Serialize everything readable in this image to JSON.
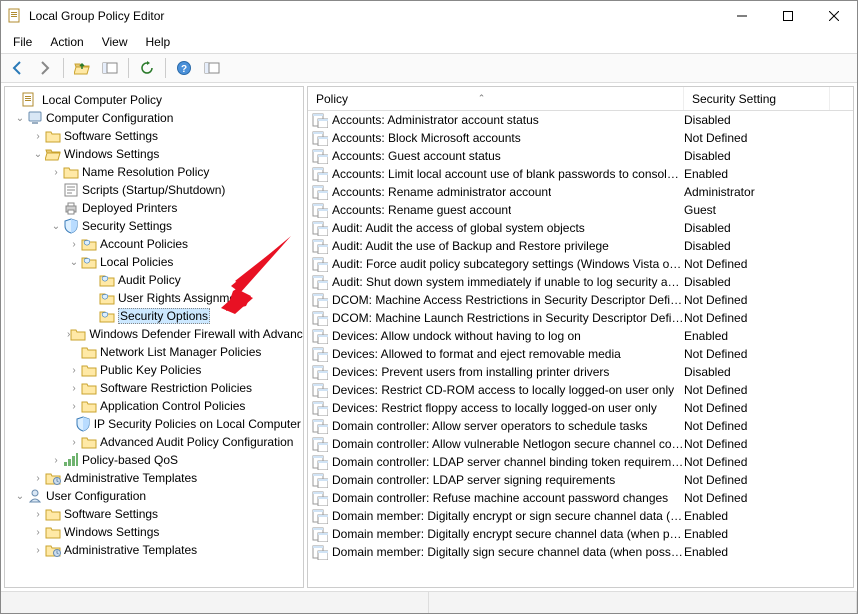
{
  "window": {
    "title": "Local Group Policy Editor"
  },
  "menu": {
    "file": "File",
    "action": "Action",
    "view": "View",
    "help": "Help"
  },
  "columns": {
    "policy": "Policy",
    "setting": "Security Setting"
  },
  "tree": {
    "root": "Local Computer Policy",
    "computer_config": "Computer Configuration",
    "software_settings_c": "Software Settings",
    "windows_settings_c": "Windows Settings",
    "name_res": "Name Resolution Policy",
    "scripts": "Scripts (Startup/Shutdown)",
    "deployed_printers": "Deployed Printers",
    "security_settings": "Security Settings",
    "account_policies": "Account Policies",
    "local_policies": "Local Policies",
    "audit_policy": "Audit Policy",
    "user_rights": "User Rights Assignment",
    "security_options": "Security Options",
    "wdf": "Windows Defender Firewall with Advanced Security",
    "nlmp": "Network List Manager Policies",
    "pkp": "Public Key Policies",
    "srp": "Software Restriction Policies",
    "acp": "Application Control Policies",
    "ipsec": "IP Security Policies on Local Computer",
    "aapc": "Advanced Audit Policy Configuration",
    "qos": "Policy-based QoS",
    "admin_tmpl_c": "Administrative Templates",
    "user_config": "User Configuration",
    "software_settings_u": "Software Settings",
    "windows_settings_u": "Windows Settings",
    "admin_tmpl_u": "Administrative Templates"
  },
  "policies": [
    {
      "name": "Accounts: Administrator account status",
      "setting": "Disabled"
    },
    {
      "name": "Accounts: Block Microsoft accounts",
      "setting": "Not Defined"
    },
    {
      "name": "Accounts: Guest account status",
      "setting": "Disabled"
    },
    {
      "name": "Accounts: Limit local account use of blank passwords to console logon only",
      "setting": "Enabled"
    },
    {
      "name": "Accounts: Rename administrator account",
      "setting": "Administrator"
    },
    {
      "name": "Accounts: Rename guest account",
      "setting": "Guest"
    },
    {
      "name": "Audit: Audit the access of global system objects",
      "setting": "Disabled"
    },
    {
      "name": "Audit: Audit the use of Backup and Restore privilege",
      "setting": "Disabled"
    },
    {
      "name": "Audit: Force audit policy subcategory settings (Windows Vista or later)",
      "setting": "Not Defined"
    },
    {
      "name": "Audit: Shut down system immediately if unable to log security audits",
      "setting": "Disabled"
    },
    {
      "name": "DCOM: Machine Access Restrictions in Security Descriptor Definition Language",
      "setting": "Not Defined"
    },
    {
      "name": "DCOM: Machine Launch Restrictions in Security Descriptor Definition Language",
      "setting": "Not Defined"
    },
    {
      "name": "Devices: Allow undock without having to log on",
      "setting": "Enabled"
    },
    {
      "name": "Devices: Allowed to format and eject removable media",
      "setting": "Not Defined"
    },
    {
      "name": "Devices: Prevent users from installing printer drivers",
      "setting": "Disabled"
    },
    {
      "name": "Devices: Restrict CD-ROM access to locally logged-on user only",
      "setting": "Not Defined"
    },
    {
      "name": "Devices: Restrict floppy access to locally logged-on user only",
      "setting": "Not Defined"
    },
    {
      "name": "Domain controller: Allow server operators to schedule tasks",
      "setting": "Not Defined"
    },
    {
      "name": "Domain controller: Allow vulnerable Netlogon secure channel connections",
      "setting": "Not Defined"
    },
    {
      "name": "Domain controller: LDAP server channel binding token requirements",
      "setting": "Not Defined"
    },
    {
      "name": "Domain controller: LDAP server signing requirements",
      "setting": "Not Defined"
    },
    {
      "name": "Domain controller: Refuse machine account password changes",
      "setting": "Not Defined"
    },
    {
      "name": "Domain member: Digitally encrypt or sign secure channel data (always)",
      "setting": "Enabled"
    },
    {
      "name": "Domain member: Digitally encrypt secure channel data (when possible)",
      "setting": "Enabled"
    },
    {
      "name": "Domain member: Digitally sign secure channel data (when possible)",
      "setting": "Enabled"
    }
  ]
}
